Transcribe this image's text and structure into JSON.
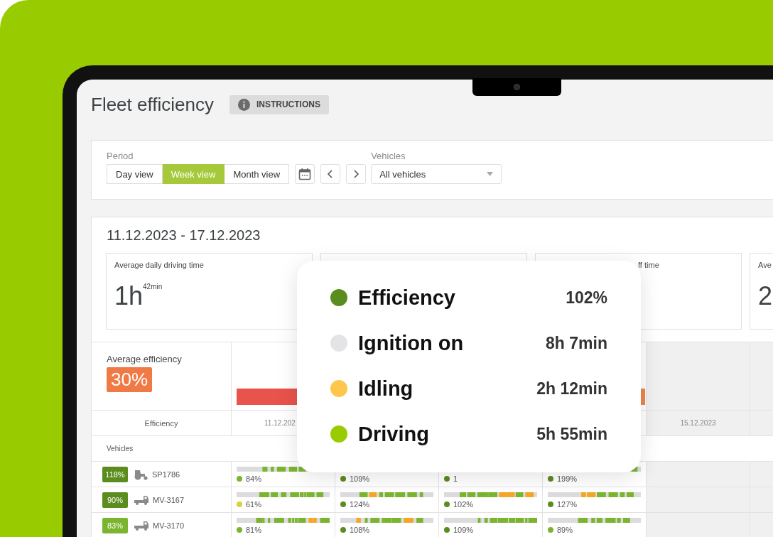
{
  "page": {
    "title": "Fleet efficiency",
    "instructions_button": "INSTRUCTIONS"
  },
  "filters": {
    "period_label": "Period",
    "views": [
      {
        "label": "Day view",
        "selected": false
      },
      {
        "label": "Week view",
        "selected": true
      },
      {
        "label": "Month view",
        "selected": false
      }
    ],
    "vehicles_label": "Vehicles",
    "vehicles_value": "All vehicles"
  },
  "report": {
    "date_range": "11.12.2023 - 17.12.2023",
    "stat_cards": [
      {
        "label": "Average daily driving time",
        "value": "1h$^{42min}$"
      },
      {
        "label": "ff time"
      },
      {
        "label": "Ave",
        "value": "2"
      }
    ],
    "average_efficiency_label": "Average efficiency",
    "average_efficiency": "30%",
    "efficiency_header": "Efficiency",
    "days": [
      {
        "date": "11.12.202",
        "future": false,
        "color": "#e8534b"
      },
      {
        "future": false
      },
      {
        "future": false
      },
      {
        "future": false,
        "color": "#f0874a"
      },
      {
        "date": "15.12.2023",
        "future": true
      },
      {
        "future": true
      }
    ],
    "vehicles_header": "Vehicles",
    "vehicles": [
      {
        "efficiency": "118%",
        "color": "#5b8c1e",
        "kind": "tractor",
        "name": "SP1786",
        "cells": [
          {
            "pct": "84%",
            "color": "#7bb52f"
          },
          {
            "pct": "109%",
            "color": "#5b8c1e"
          },
          {
            "pct": "1",
            "color": "#5b8c1e"
          },
          {
            "pct": "199%",
            "color": "#5b8c1e"
          }
        ]
      },
      {
        "efficiency": "90%",
        "color": "#5b8c1e",
        "kind": "truck",
        "name": "MV-3167",
        "cells": [
          {
            "pct": "61%",
            "color": "#d6d33c"
          },
          {
            "pct": "124%",
            "color": "#5b8c1e"
          },
          {
            "pct": "102%",
            "color": "#5b8c1e"
          },
          {
            "pct": "127%",
            "color": "#5b8c1e"
          }
        ]
      },
      {
        "efficiency": "83%",
        "color": "#7bb52f",
        "kind": "truck",
        "name": "MV-3170",
        "cells": [
          {
            "pct": "81%",
            "color": "#7bb52f"
          },
          {
            "pct": "108%",
            "color": "#5b8c1e"
          },
          {
            "pct": "109%",
            "color": "#5b8c1e"
          },
          {
            "pct": "89%",
            "color": "#7bb52f"
          }
        ]
      }
    ]
  },
  "tooltip": [
    {
      "label": "Efficiency",
      "value": "102%",
      "color": "#5b8c1e"
    },
    {
      "label": "Ignition on",
      "value": "8h 7min",
      "color": "#e4e4e6"
    },
    {
      "label": "Idling",
      "value": "2h 12min",
      "color": "#ffc64d"
    },
    {
      "label": "Driving",
      "value": "5h 55min",
      "color": "#99cc00"
    }
  ]
}
